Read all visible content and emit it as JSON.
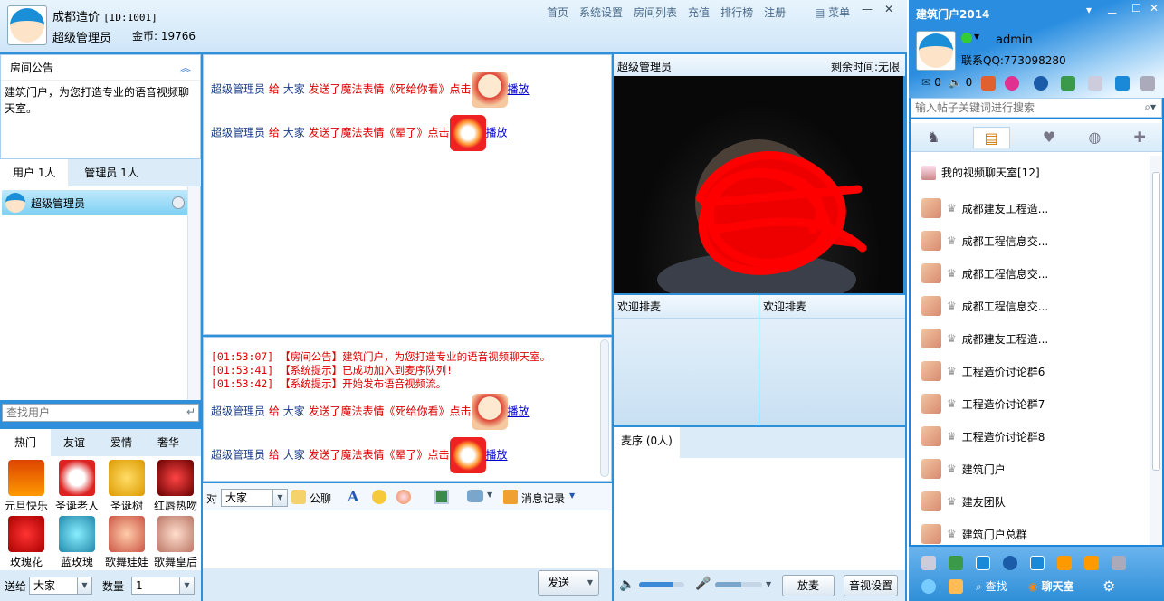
{
  "header": {
    "room_name": "成都造价",
    "room_id": "[ID:1001]",
    "user_role": "超级管理员",
    "coins_label": "金币:",
    "coins": "19766",
    "nav": [
      "首页",
      "系统设置",
      "房间列表",
      "充值",
      "排行榜",
      "注册"
    ],
    "menu_label": "菜单"
  },
  "announcement": {
    "title": "房间公告",
    "text": "建筑门户，为您打造专业的语音视频聊天室。"
  },
  "user_tabs": [
    "用户 1人",
    "管理员 1人"
  ],
  "users": [
    {
      "name": "超级管理员"
    }
  ],
  "search_user": {
    "placeholder": "查找用户"
  },
  "gift_tabs": [
    "热门",
    "友谊",
    "爱情",
    "奢华"
  ],
  "gifts": [
    "元旦快乐",
    "圣诞老人",
    "圣诞树",
    "红唇热吻",
    "玫瑰花",
    "蓝玫瑰",
    "歌舞娃娃",
    "歌舞皇后"
  ],
  "send_to": {
    "label": "送给",
    "value": "大家",
    "qty_label": "数量",
    "qty": "1"
  },
  "public_chat": [
    {
      "sender": "超级管理员",
      "verb": "给",
      "target": "大家",
      "action": "发送了魔法表情《死给你看》点击",
      "link": "播放"
    },
    {
      "sender": "超级管理员",
      "verb": "给",
      "target": "大家",
      "action": "发送了魔法表情《晕了》点击",
      "link": "播放"
    }
  ],
  "system_msgs": [
    "[01:53:07] 【房间公告】建筑门户，为您打造专业的语音视频聊天室。",
    "[01:53:41] 【系统提示】已成功加入到麦序队列!",
    "[01:53:42] 【系统提示】开始发布语音视频流。"
  ],
  "private_chat": [
    {
      "sender": "超级管理员",
      "verb": "给",
      "target": "大家",
      "action": "发送了魔法表情《死给你看》点击",
      "link": "播放"
    },
    {
      "sender": "超级管理员",
      "verb": "给",
      "target": "大家",
      "action": "发送了魔法表情《晕了》点击",
      "link": "播放"
    }
  ],
  "toolbar": {
    "to_label": "对",
    "to_value": "大家",
    "public_label": "公聊",
    "history_label": "消息记录"
  },
  "send_label": "发送",
  "video": {
    "owner": "超级管理员",
    "time_label": "剩余时间:无限",
    "slot1": "欢迎排麦",
    "slot2": "欢迎排麦"
  },
  "mic_queue": {
    "label": "麦序 (0人)"
  },
  "controls": {
    "release": "放麦",
    "av_settings": "音视设置",
    "volume": 0.75,
    "mic_level": 0.55
  },
  "sidebar": {
    "title": "建筑门户2014",
    "username": "admin",
    "qq": "联系QQ:773098280",
    "mail_count": "0",
    "msg_count": "0",
    "search_placeholder": "输入帖子关键词进行搜索",
    "group_header": "我的视频聊天室[12]",
    "items": [
      "成都建友工程造...",
      "成都工程信息交...",
      "成都工程信息交...",
      "成都工程信息交...",
      "成都建友工程造...",
      "工程造价讨论群6",
      "工程造价讨论群7",
      "工程造价讨论群8",
      "建筑门户",
      "建友团队",
      "建筑门户总群"
    ],
    "find_label": "查找",
    "chatroom_label": "聊天室"
  },
  "colors": {
    "accent": "#2f8fd8",
    "link": "#0000cc",
    "alert": "#dd0000",
    "name": "#1a3d8a"
  }
}
